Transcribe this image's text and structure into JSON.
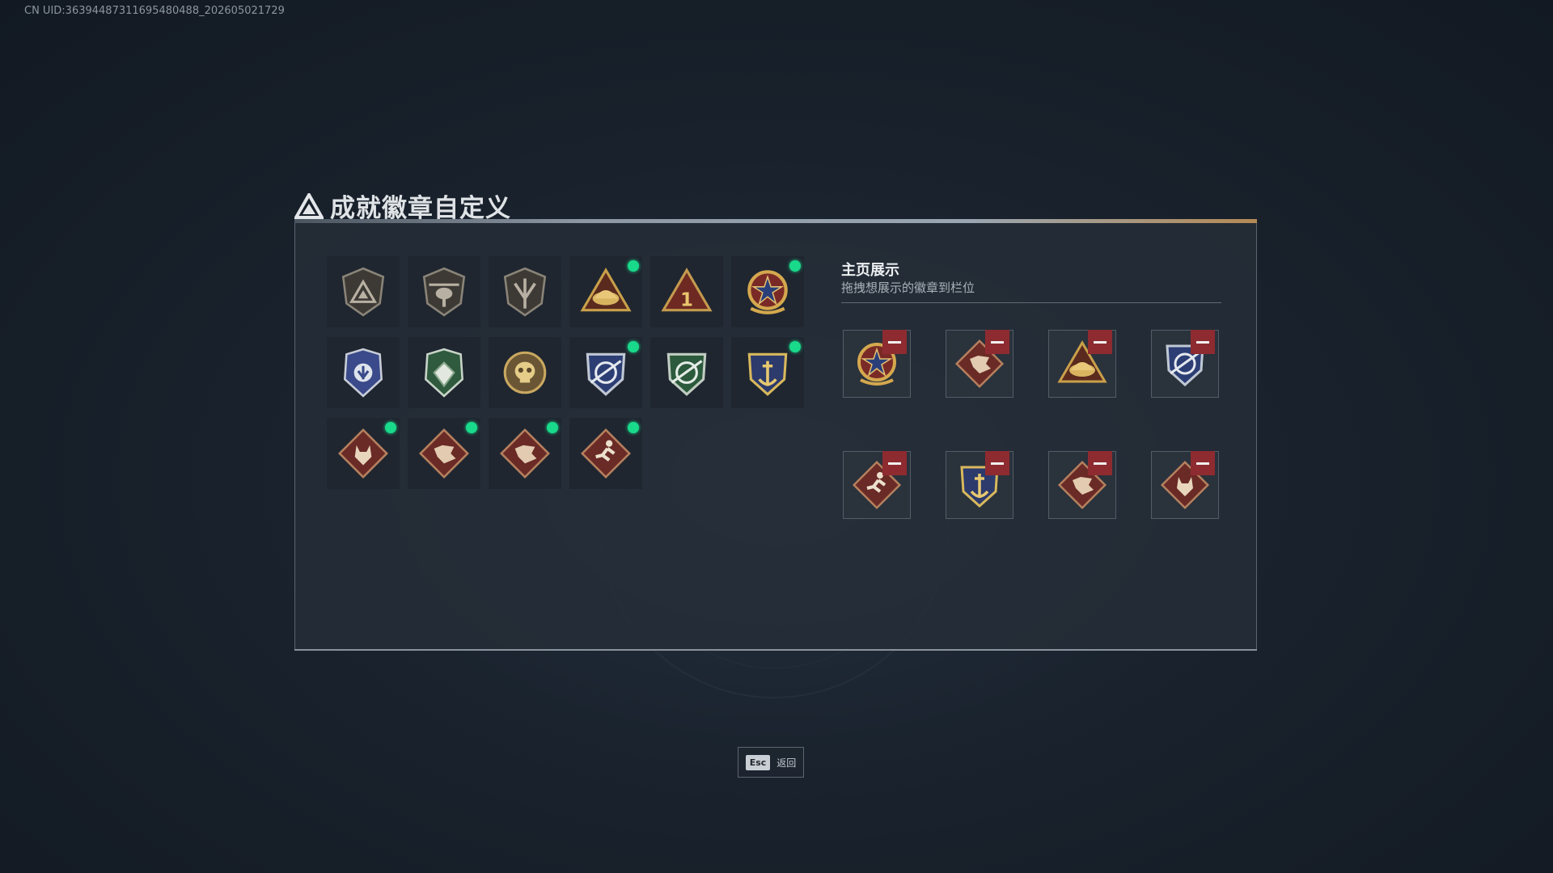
{
  "uid_text": "CN UID:3639448731169548048​8_202605021729",
  "title": "成就徽章自定义",
  "display_section": {
    "title": "主页展示",
    "subtitle": "拖拽想展示的徽章到栏位"
  },
  "badges": [
    {
      "icon": "triangle-shield-badge-icon",
      "new": false
    },
    {
      "icon": "helicopter-shield-badge-icon",
      "new": false
    },
    {
      "icon": "wing-shield-badge-icon",
      "new": false
    },
    {
      "icon": "golden-triangle-badge-icon",
      "new": true
    },
    {
      "icon": "number-one-triangle-badge-icon",
      "new": false
    },
    {
      "icon": "star-medal-badge-icon",
      "new": true
    },
    {
      "icon": "blue-police-badge-icon",
      "new": false
    },
    {
      "icon": "green-police-badge-icon",
      "new": false
    },
    {
      "icon": "gold-skull-badge-icon",
      "new": false
    },
    {
      "icon": "blue-sniper-crest-badge-icon",
      "new": true
    },
    {
      "icon": "green-sniper-crest-badge-icon",
      "new": false
    },
    {
      "icon": "gold-anchor-crest-badge-icon",
      "new": true
    },
    {
      "icon": "wolf-diamond-badge-icon",
      "new": true
    },
    {
      "icon": "dragon-diamond-badge-icon",
      "new": true
    },
    {
      "icon": "dragon-diamond-badge-icon",
      "new": true
    },
    {
      "icon": "runner-diamond-badge-icon",
      "new": true
    }
  ],
  "display_slots": [
    {
      "icon": "star-medal-badge-icon"
    },
    {
      "icon": "dragon-diamond-badge-icon"
    },
    {
      "icon": "golden-triangle-badge-icon"
    },
    {
      "icon": "blue-sniper-crest-badge-icon"
    },
    {
      "icon": "runner-diamond-badge-icon"
    },
    {
      "icon": "gold-anchor-crest-badge-icon"
    },
    {
      "icon": "dragon-diamond-badge-icon"
    },
    {
      "icon": "wolf-diamond-badge-icon"
    }
  ],
  "esc": {
    "key": "Esc",
    "label": "返回"
  },
  "colors": {
    "new_dot": "#19d98a",
    "remove_button": "#8e2b30",
    "panel": "#262e38"
  }
}
